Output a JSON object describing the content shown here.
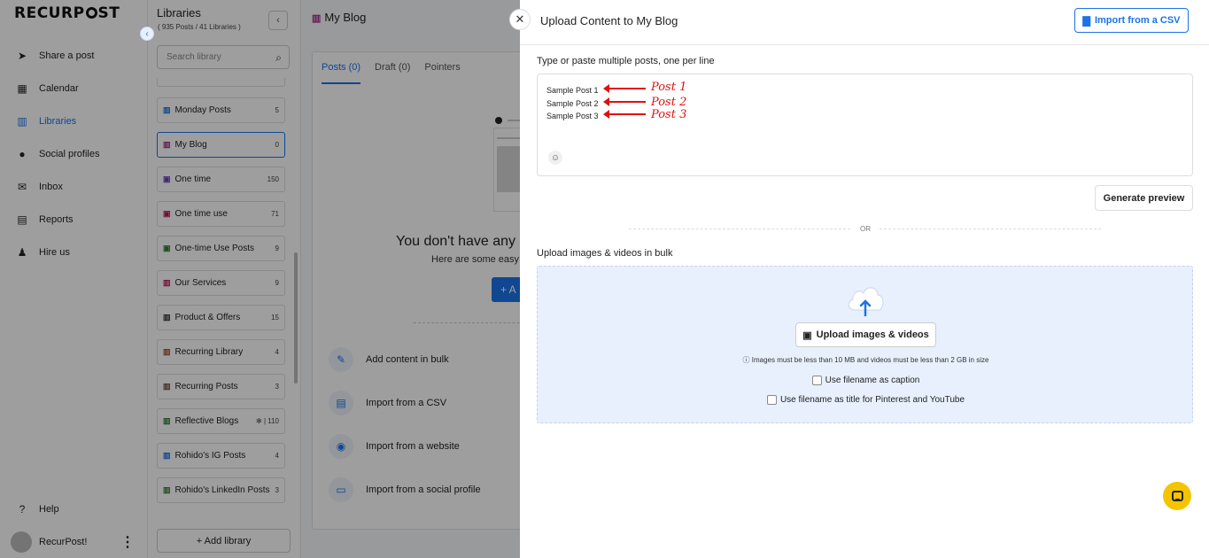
{
  "sidebar": {
    "logo_left": "RECURP",
    "logo_right": "ST",
    "items": [
      {
        "label": "Share a post",
        "icon": "send-icon"
      },
      {
        "label": "Calendar",
        "icon": "calendar-icon"
      },
      {
        "label": "Libraries",
        "icon": "libraries-icon",
        "active": true
      },
      {
        "label": "Social profiles",
        "icon": "profile-icon"
      },
      {
        "label": "Inbox",
        "icon": "inbox-icon"
      },
      {
        "label": "Reports",
        "icon": "reports-icon"
      },
      {
        "label": "Hire us",
        "icon": "person-icon"
      }
    ],
    "help_label": "Help",
    "account_label": "RecurPost!"
  },
  "libraries": {
    "title": "Libraries",
    "subtitle": "( 935 Posts / 41 Libraries )",
    "search_placeholder": "Search library",
    "items": [
      {
        "label": "Monday Posts",
        "count": "5",
        "color": "#1a73e8"
      },
      {
        "label": "My Blog",
        "count": "0",
        "color": "#9c2a8a"
      },
      {
        "label": "One time",
        "count": "150",
        "color": "#6a3fc4"
      },
      {
        "label": "One time use",
        "count": "71",
        "color": "#c2185b"
      },
      {
        "label": "One-time Use Posts",
        "count": "9",
        "color": "#2e7d32"
      },
      {
        "label": "Our Services",
        "count": "9",
        "color": "#c2185b"
      },
      {
        "label": "Product & Offers",
        "count": "15",
        "color": "#333333"
      },
      {
        "label": "Recurring Library",
        "count": "4",
        "color": "#a0522d"
      },
      {
        "label": "Recurring Posts",
        "count": "3",
        "color": "#6d4c41"
      },
      {
        "label": "Reflective Blogs",
        "count": "✻ | 110",
        "color": "#2e7d32"
      },
      {
        "label": "Rohido's IG Posts",
        "count": "4",
        "color": "#1a73e8"
      },
      {
        "label": "Rohido's LinkedIn Posts",
        "count": "3",
        "color": "#2e7d32"
      }
    ],
    "add_label": "+ Add library"
  },
  "main": {
    "title": "My Blog",
    "tabs": [
      "Posts (0)",
      "Draft (0)",
      "Pointers"
    ],
    "empty_title": "You don't have any",
    "empty_sub": "Here are some easy",
    "empty_btn": "+ A",
    "actions": [
      {
        "label": "Add content in bulk",
        "icon": "pencil-icon"
      },
      {
        "label": "Import from a CSV",
        "icon": "csv-icon"
      },
      {
        "label": "Import from a website",
        "icon": "rss-icon"
      },
      {
        "label": "Import from a social profile",
        "icon": "chat-icon"
      }
    ]
  },
  "drawer": {
    "title": "Upload Content to My Blog",
    "csv_button": "Import from a CSV",
    "posts_label": "Type or paste multiple posts, one per line",
    "posts_lines": [
      "Sample Post 1",
      "Sample Post 2",
      "Sample Post 3"
    ],
    "annotations": [
      "Post 1",
      "Post 2",
      "Post 3"
    ],
    "generate_button": "Generate preview",
    "or_text": "OR",
    "bulk_label": "Upload images & videos in bulk",
    "upload_button": "Upload images & videos",
    "upload_info": "Images must be less than 10 MB and videos must be less than 2 GB in size",
    "checkbox_caption": "Use filename as caption",
    "checkbox_title": "Use filename as title for Pinterest and YouTube"
  },
  "colors": {
    "accent": "#1a73e8",
    "annotation": "#e01010",
    "chat": "#f5c400"
  }
}
